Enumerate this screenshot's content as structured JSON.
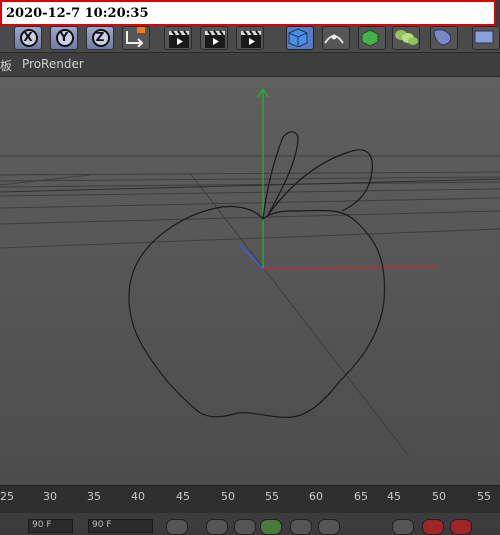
{
  "timestamp": "2020-12-7  10:20:35",
  "toolbar": {
    "axis_buttons": [
      "X",
      "Y",
      "Z"
    ],
    "icons": [
      "axis-x-icon",
      "axis-y-icon",
      "axis-z-icon",
      "coordinate-system-icon",
      "render-view-icon",
      "render-picture-viewer-icon",
      "render-settings-icon",
      "cube-icon",
      "spline-pen-icon",
      "subdivision-icon",
      "array-icon",
      "deformer-icon",
      "scene-icon"
    ]
  },
  "menubar": {
    "left_fragment": "板",
    "item": "ProRender"
  },
  "viewport": {
    "background": "#555555",
    "axis_colors": {
      "x": "#c8282a",
      "y": "#1fb82a",
      "z": "#3a5cff"
    }
  },
  "timeline": {
    "ticks": [
      "25",
      "30",
      "35",
      "40",
      "45",
      "50",
      "55",
      "60",
      "65",
      "45",
      "50",
      "55"
    ]
  },
  "controls": {
    "start_field": "90 F",
    "end_field": "90 F"
  }
}
